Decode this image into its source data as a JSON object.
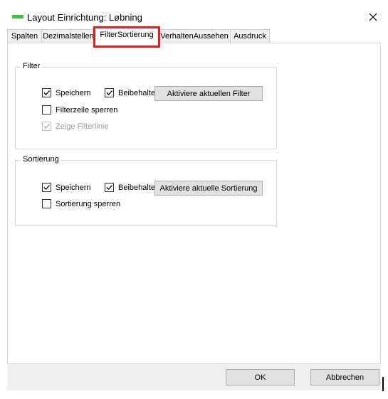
{
  "window": {
    "title": "Layout Einrichtung: Løbning",
    "accent_color": "#3ec33e",
    "close_icon": "close-icon"
  },
  "tabs": [
    {
      "label": "Spalten",
      "active": false
    },
    {
      "label": "Dezimalstellen",
      "active": false
    },
    {
      "label": "FilterSortierung",
      "active": true
    },
    {
      "label": "VerhaltenAussehen",
      "active": false
    },
    {
      "label": "Ausdruck",
      "active": false
    }
  ],
  "highlight_color": "#e21b1b",
  "filter_group": {
    "title": "Filter",
    "save_label": "Speichern",
    "save_checked": true,
    "keep_label": "Beibehalte",
    "keep_checked": true,
    "activate_button": "Aktiviere aktuellen Filter",
    "lock_label": "Filterzeile sperren",
    "lock_checked": false,
    "show_line_label": "Zeige Filterlinie",
    "show_line_checked": true,
    "show_line_disabled": true
  },
  "sort_group": {
    "title": "Sortierung",
    "save_label": "Speichern",
    "save_checked": true,
    "keep_label": "Beibehalte",
    "keep_checked": true,
    "activate_button": "Aktiviere aktuelle Sortierung",
    "lock_label": "Sortierung sperren",
    "lock_checked": false
  },
  "footer": {
    "ok_label": "OK",
    "cancel_label": "Abbrechen"
  }
}
